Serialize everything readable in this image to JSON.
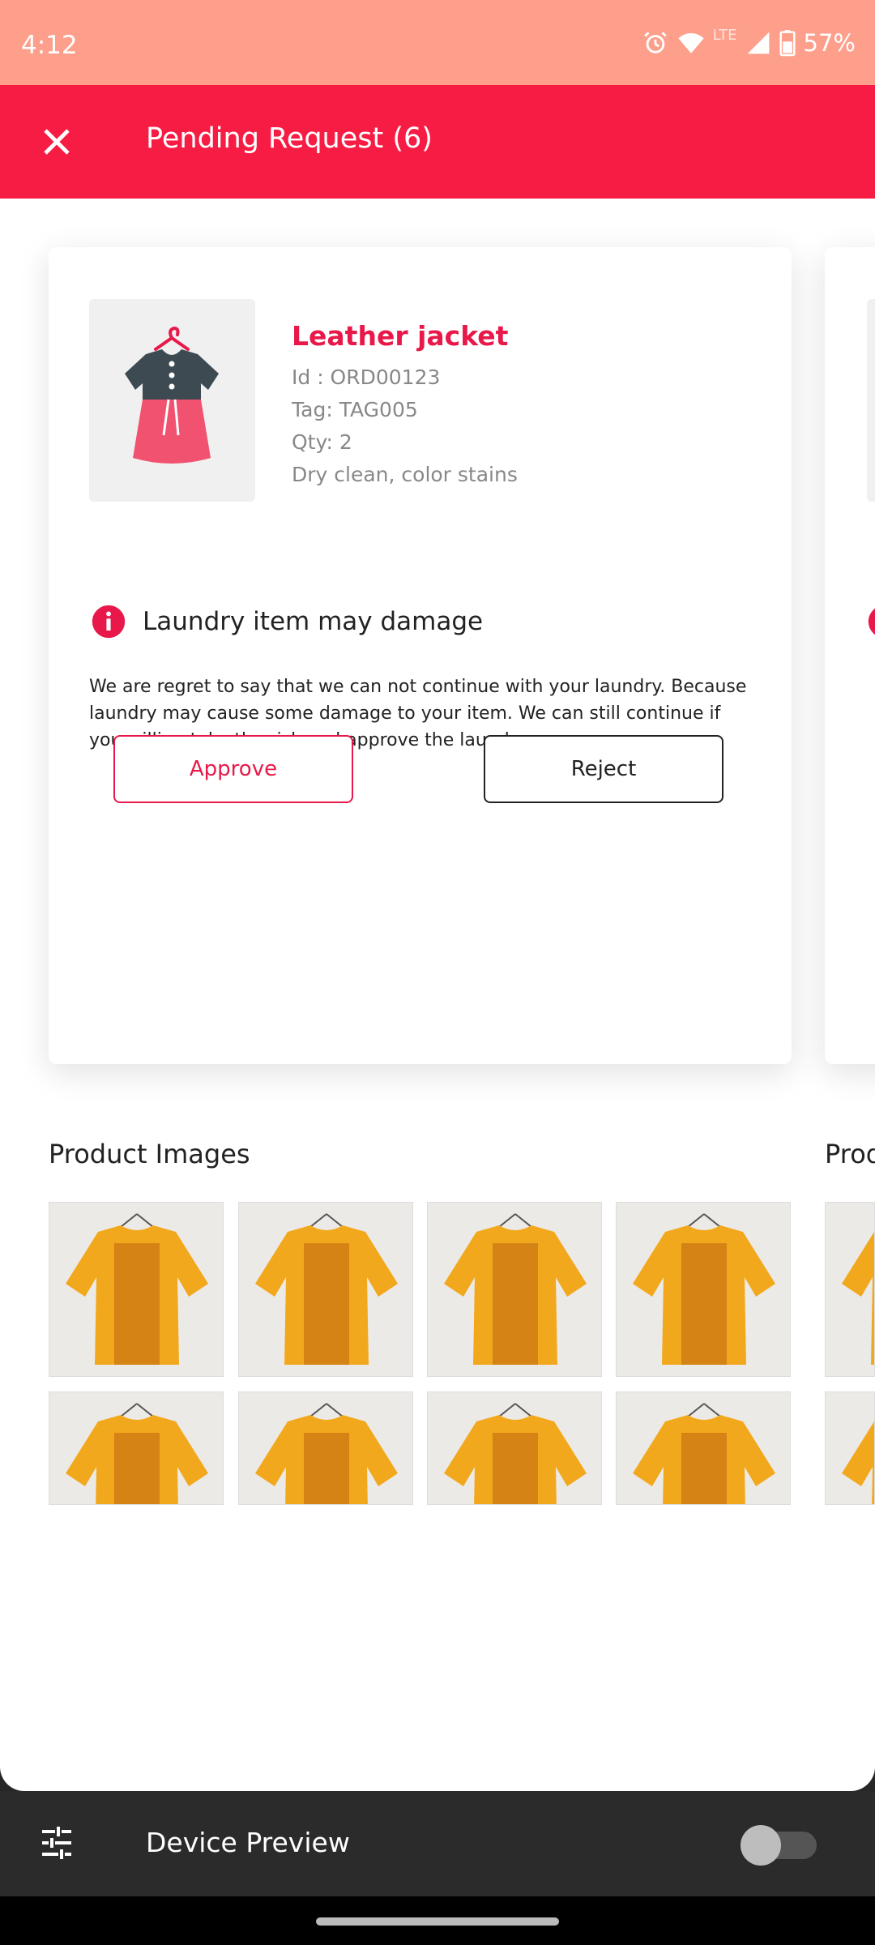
{
  "status_bar": {
    "time": "4:12",
    "network": "LTE",
    "battery": "57%"
  },
  "app_bar": {
    "title": "Pending Request (6)"
  },
  "request": {
    "item_name": "Leather jacket",
    "id": "Id : ORD00123",
    "tag": "Tag: TAG005",
    "qty": "Qty: 2",
    "service": "Dry clean, color stains",
    "warning_title": "Laundry item may damage",
    "warning_text": "We are regret to say that we can not continue with your laundry. Because laundry may cause some damage to your item. We can still continue if you willing take the risk and approve the laundry.",
    "approve_label": "Approve",
    "reject_label": "Reject"
  },
  "product_images": {
    "title": "Product Images",
    "next_title": "Prod"
  },
  "device_preview": {
    "label": "Device Preview"
  },
  "colors": {
    "accent": "#f71c44",
    "status_bar": "#fd9f8b"
  }
}
